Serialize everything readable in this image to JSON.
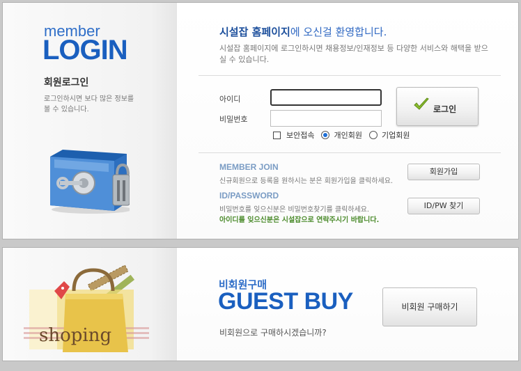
{
  "login_panel": {
    "member_word": "member",
    "login_word": "LOGIN",
    "heading": "회원로그인",
    "description": "로그인하시면 보다 많은 정보를 볼 수 있습니다.",
    "welcome_bold": "시설잡 홈페이지",
    "welcome_rest": "에 오신걸 환영합니다.",
    "intro": "시설잡 홈페이지에 로그인하시면 채용정보/인재정보 등 다양한 서비스와 해택을 받으실 수 있습니다.",
    "id_label": "아이디",
    "password_label": "비밀번호",
    "id_value": "",
    "password_value": "",
    "login_button": "로그인",
    "options": {
      "secure_login": "보안접속",
      "secure_checked": false,
      "personal_member": "개인회원",
      "corporate_member": "기업회원",
      "selected": "personal"
    },
    "join": {
      "title": "MEMBER JOIN",
      "description": "신규회원으로 등록을 원하시는 분은 회원가입을 클릭하세요.",
      "button": "회원가입"
    },
    "find": {
      "title": "ID/PASSWORD",
      "description": "비밀번호를 잊으신분은 비밀번호찾기를 클릭하세요.",
      "note": "아이디를 잊으신분은 시설잡으로 연락주시기 바랍니다.",
      "button": "ID/PW 찾기"
    }
  },
  "guest_panel": {
    "small_title": "비회원구매",
    "big_title": "GUEST BUY",
    "question": "비회원으로 구매하시겠습니까?",
    "button": "비회원 구매하기",
    "bag_text": "shoping"
  },
  "colors": {
    "brand_blue": "#1a5fbf",
    "accent_green": "#4a8a2a",
    "radio_blue": "#1f6fd6"
  }
}
